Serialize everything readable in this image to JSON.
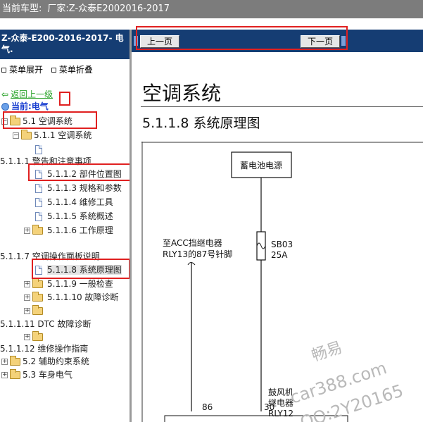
{
  "title_bar": {
    "label": "当前车型:",
    "vehicle": "厂家:Z-众泰E2002016-2017"
  },
  "sidebar": {
    "header_line1": "Z-众泰-E200-2016-2017- 电",
    "header_line2": "气.",
    "expand_all": "菜单展开",
    "collapse_all": "菜单折叠",
    "back": "返回上一级",
    "current": "当前:电气",
    "tree": [
      {
        "label": "5.1 空调系统"
      },
      {
        "label": "5.1.1 空调系统"
      },
      {
        "label": ""
      },
      {
        "label": "5.1.1.1 警告和注意事项"
      },
      {
        "label": "5.1.1.2 部件位置图"
      },
      {
        "label": "5.1.1.3 规格和参数"
      },
      {
        "label": "5.1.1.4 维修工具"
      },
      {
        "label": "5.1.1.5 系统概述"
      },
      {
        "label": "5.1.1.6 工作原理"
      },
      {
        "label": "5.1.1.7 空调操作面板说明"
      },
      {
        "label": "5.1.1.8 系统原理图"
      },
      {
        "label": "5.1.1.9 一般检查"
      },
      {
        "label": "5.1.1.10 故障诊断"
      },
      {
        "label": ""
      },
      {
        "label": "5.1.1.11 DTC 故障诊断"
      },
      {
        "label": ""
      },
      {
        "label": "5.1.1.12 维修操作指南"
      },
      {
        "label": "5.2 辅助约束系统"
      },
      {
        "label": "5.3 车身电气"
      }
    ]
  },
  "nav": {
    "prev": "上一页",
    "next": "下一页"
  },
  "content": {
    "title": "空调系统",
    "subtitle": "5.1.1.8 系统原理图",
    "diagram": {
      "battery": "蓄电池电源",
      "acc_line1": "至ACC挡继电器",
      "acc_line2": "RLY13的87号针脚",
      "fuse_name": "SB03",
      "fuse_rating": "25A",
      "pin_86": "86",
      "pin_30": "30",
      "relay_line1": "鼓风机",
      "relay_line2": "继电器",
      "relay_line3": "RLY12"
    },
    "watermark": {
      "line1": "畅易",
      "line2": "car388.com",
      "line3": "QQ:2Y20165"
    }
  },
  "colors": {
    "header_bg": "#153d73",
    "titlebar_bg": "#7c7c7c",
    "highlight_border": "#e02020",
    "back_link": "#2aa32a",
    "current_link": "#1a3fd0"
  }
}
